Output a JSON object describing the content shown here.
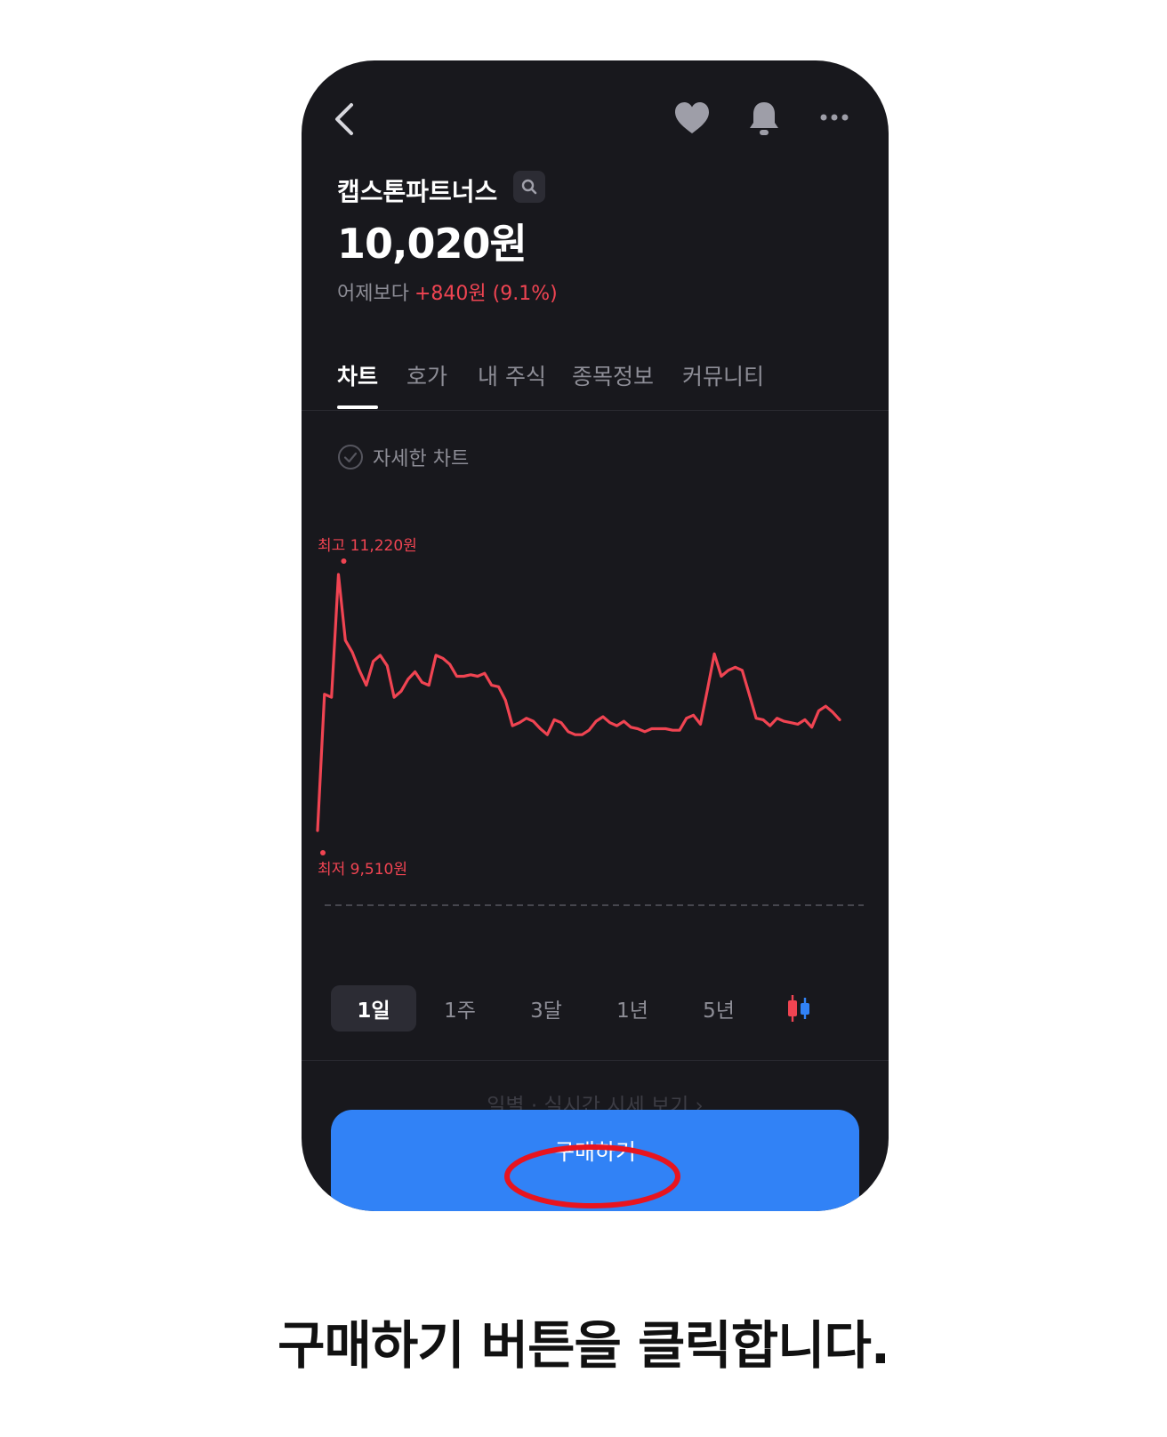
{
  "stock": {
    "name": "캡스톤파트너스",
    "price": "10,020원",
    "change_label": "어제보다",
    "change_value": "+840원 (9.1%)"
  },
  "tabs": [
    {
      "label": "차트",
      "active": true
    },
    {
      "label": "호가",
      "active": false
    },
    {
      "label": "내 주식",
      "active": false
    },
    {
      "label": "종목정보",
      "active": false
    },
    {
      "label": "커뮤니티",
      "active": false
    }
  ],
  "detail_chart_label": "자세한 차트",
  "chart_data": {
    "type": "line",
    "high_label": "최고 11,220원",
    "low_label": "최저 9,510원",
    "high": 11220,
    "low": 9510,
    "ylim": [
      9510,
      11220
    ],
    "series": [
      {
        "color": "#f04452",
        "values": [
          9510,
          10420,
          10400,
          11220,
          10780,
          10700,
          10580,
          10480,
          10640,
          10680,
          10610,
          10400,
          10440,
          10520,
          10570,
          10500,
          10480,
          10680,
          10660,
          10620,
          10540,
          10540,
          10550,
          10540,
          10560,
          10480,
          10470,
          10380,
          10210,
          10230,
          10260,
          10240,
          10190,
          10150,
          10250,
          10230,
          10170,
          10150,
          10150,
          10180,
          10240,
          10270,
          10230,
          10210,
          10240,
          10200,
          10190,
          10170,
          10190,
          10190,
          10190,
          10180,
          10180,
          10260,
          10280,
          10220,
          10450,
          10690,
          10540,
          10580,
          10600,
          10580,
          10420,
          10260,
          10250,
          10210,
          10260,
          10240,
          10230,
          10220,
          10250,
          10200,
          10310,
          10340,
          10300,
          10250
        ]
      }
    ]
  },
  "periods": [
    {
      "label": "1일",
      "active": true
    },
    {
      "label": "1주",
      "active": false
    },
    {
      "label": "3달",
      "active": false
    },
    {
      "label": "1년",
      "active": false
    },
    {
      "label": "5년",
      "active": false
    }
  ],
  "daily_link": "일별 · 실시간 시세 보기",
  "buy_button": "구매하기",
  "caption": "구매하기 버튼을 클릭합니다.",
  "colors": {
    "background": "#18181d",
    "accent": "#3182f6",
    "rise": "#f04452",
    "highlight_ring": "#e8141e"
  },
  "icons": [
    "back-arrow-icon",
    "heart-icon",
    "bell-icon",
    "more-icon",
    "search-icon",
    "check-circle-icon",
    "candlestick-icon"
  ]
}
